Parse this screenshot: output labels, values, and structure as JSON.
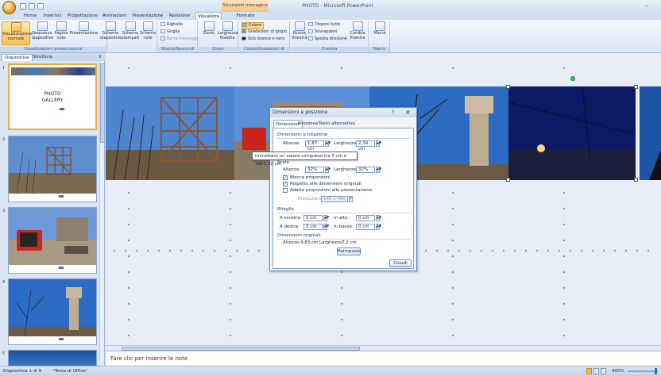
{
  "window": {
    "title": "PHOTO - Microsoft PowerPoint",
    "contextual_tab": "Strumenti immagine",
    "minimize_glyph": "–"
  },
  "tabs": [
    "Home",
    "Inserisci",
    "Progettazione",
    "Animazioni",
    "Presentazione",
    "Revisione",
    "Visualizza",
    "Formato"
  ],
  "ribbon": {
    "groups": [
      "Visualizzazioni presentazione",
      "Mostra/Nascondi",
      "Zoom",
      "Colore/Gradazioni di grigio",
      "Finestra",
      "Macro"
    ],
    "views": [
      "Visualizzazione normale",
      "Sequenza diapositive",
      "Pagina note",
      "Presentazione",
      "Schema diapositive",
      "Schema stampati",
      "Schema note"
    ],
    "show": [
      "Righello",
      "Griglia",
      "Barra messaggi"
    ],
    "zoom": [
      "Zoom",
      "Larghezza finestra"
    ],
    "color": [
      "Colore",
      "Gradazioni di grigio",
      "Solo bianco e nero"
    ],
    "window": [
      "Nuova finestra",
      "Disponi tutto",
      "Sovrapponi",
      "Sposta divisione",
      "Cambia finestra"
    ],
    "macro": [
      "Macro"
    ]
  },
  "pane": {
    "tabs": [
      "Diapositive",
      "Struttura"
    ],
    "close": "x",
    "slide_numbers": [
      "1",
      "2",
      "3",
      "4",
      "5"
    ],
    "first_slide_title": "PHOTO\nGALLERY"
  },
  "notes_placeholder": "Fare clic per inserire le note",
  "status": {
    "slide": "Diapositiva 1 di 9",
    "theme": "\"Tema di Office\"",
    "zoom": "400%"
  },
  "dialog": {
    "title": "Dimensioni e posizione",
    "help": "?",
    "close": "×",
    "tabs": [
      "Dimensioni",
      "Posizione",
      "Testo alternativo"
    ],
    "sec_size": "Dimensioni e rotazione",
    "height_label": "Altezza:",
    "height_value": "1,87 cm",
    "width_label": "Larghezza:",
    "width_value": "2,34 cm",
    "scale": "Scala",
    "scale_h_label": "Altezza:",
    "scale_h_value": "32%",
    "scale_w_label": "Larghezza:",
    "scale_w_value": "32%",
    "lock": "Blocca proporzioni",
    "relative": "Rispetto alle dimensioni originali",
    "best": "Adatta proporzioni alla presentazione",
    "res_label": "Risoluzione:",
    "res_value": "640 x 480",
    "sec_crop": "Ritaglia",
    "left_label": "A sinistra:",
    "left_value": "0 cm",
    "top_label": "In alto:",
    "top_value": "0 cm",
    "right_label": "A destra:",
    "right_value": "0 cm",
    "bottom_label": "In basso:",
    "bottom_value": "0 cm",
    "sec_orig": "Dimensioni originali",
    "orig_h_label": "Altezza:",
    "orig_h_value": "4,83 cm",
    "orig_w_label": "Larghezza:",
    "orig_w_value": "7,2 cm",
    "reset": "Reimposta",
    "close_btn": "Chiudi",
    "tooltip": "Immettere un valore compreso tra 0 cm e 3863,92 cm"
  },
  "colors": {
    "accent": "#f2a93b",
    "sky": "#1e5fb4",
    "night": "#0c1a66",
    "rust": "#8b5a34"
  }
}
